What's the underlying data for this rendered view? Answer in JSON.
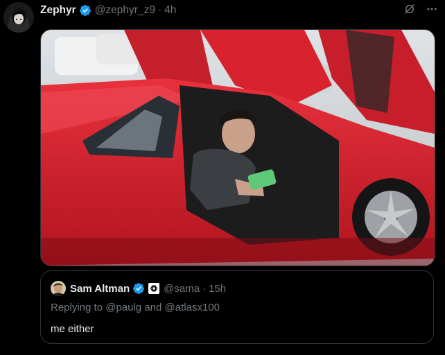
{
  "tweet": {
    "author_name": "Zephyr",
    "author_handle": "@zephyr_z9",
    "separator": "·",
    "time": "4h",
    "avatar_icon": "anime-avatar",
    "verified_icon": "verified-badge-icon",
    "action_icons": [
      "grok-icon",
      "more-icon"
    ]
  },
  "media": {
    "description_icon": "video-thumbnail"
  },
  "quoted_tweet": {
    "author_name": "Sam Altman",
    "author_handle": "@sama",
    "separator": "·",
    "time": "15h",
    "reply_prefix": "Replying to ",
    "reply_user_1": "@paulg",
    "reply_and": " and ",
    "reply_user_2": "@atlasx100",
    "text": "me either"
  },
  "colors": {
    "background": "#000000",
    "verified": "#1d9bf0",
    "text_primary": "#e7e9ea",
    "text_secondary": "#71767b",
    "border": "#2f3336"
  }
}
